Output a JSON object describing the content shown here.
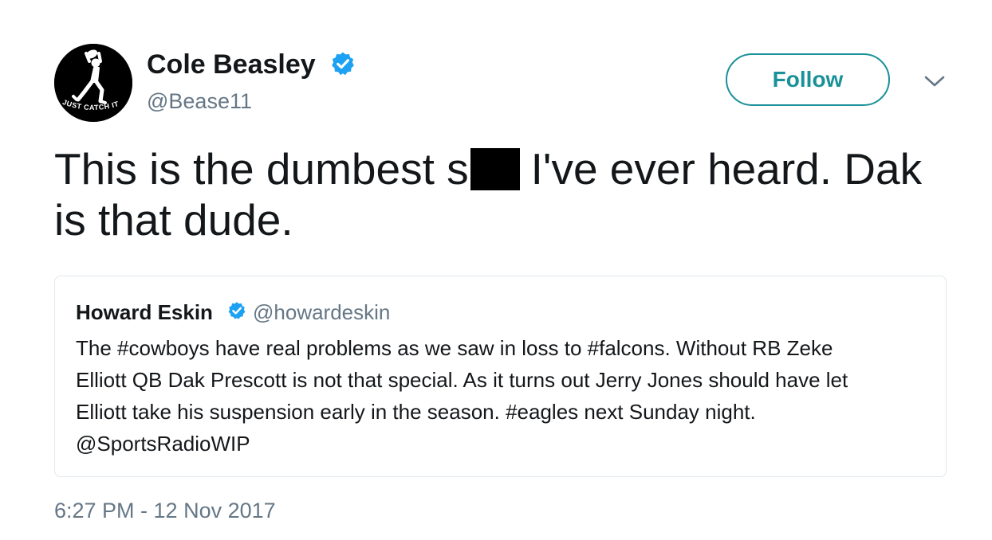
{
  "author": {
    "name": "Cole Beasley",
    "handle": "@Bease11",
    "verified": true,
    "avatar_icon": "football-player-catch-avatar",
    "avatar_text": "JUST CATCH IT"
  },
  "follow_button": {
    "label": "Follow"
  },
  "menu": {
    "icon": "chevron-down-icon"
  },
  "tweet": {
    "text_part1": "This is the dumbest s",
    "redaction": "[redacted]",
    "text_part2": "I've ever heard. Dak",
    "text_part3": "is that dude."
  },
  "quoted_tweet": {
    "name": "Howard Eskin",
    "handle": "@howardeskin",
    "verified": true,
    "lines": [
      "The #cowboys have real problems as we saw in loss to #falcons. Without RB Zeke",
      "Elliott QB Dak Prescott is not that special. As it turns out Jerry Jones should have let",
      "Elliott take his suspension early in the season. #eagles next Sunday night.",
      "@SportsRadioWIP"
    ]
  },
  "timestamp": "6:27 PM - 12 Nov 2017",
  "colors": {
    "accent": "#1a9198",
    "verified": "#1da1f2",
    "text_primary": "#14171a",
    "text_secondary": "#657786",
    "border": "#e1e8ed"
  }
}
